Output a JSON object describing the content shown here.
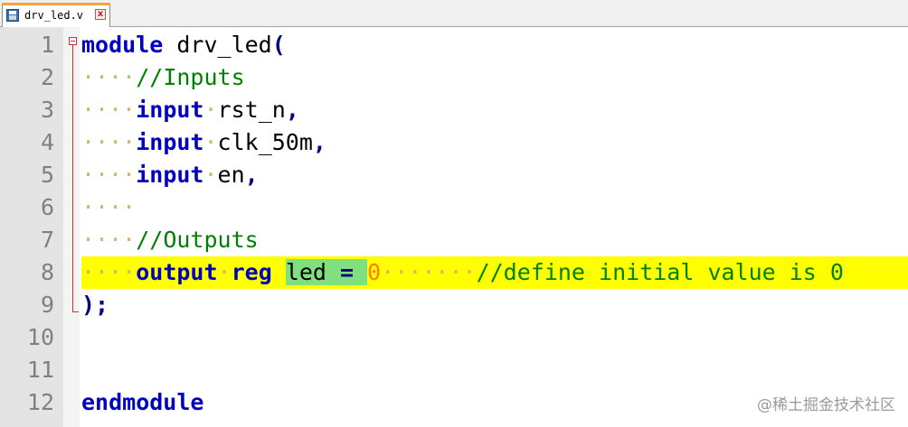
{
  "tab": {
    "filename": "drv_led.v",
    "close_glyph": "x",
    "icon": "save-icon"
  },
  "editor": {
    "lines": [
      {
        "no": "1",
        "indent": "",
        "tokens": [
          {
            "t": "module",
            "k": "kw"
          },
          {
            "t": " drv_led",
            "k": "id"
          },
          {
            "t": "(",
            "k": "op"
          }
        ]
      },
      {
        "no": "2",
        "indent": "····",
        "tokens": [
          {
            "t": "//Inputs",
            "k": "cm"
          }
        ]
      },
      {
        "no": "3",
        "indent": "····",
        "tokens": [
          {
            "t": "input",
            "k": "kw"
          },
          {
            "t": "·",
            "k": "ws"
          },
          {
            "t": "rst_n",
            "k": "id"
          },
          {
            "t": ",",
            "k": "op"
          }
        ]
      },
      {
        "no": "4",
        "indent": "····",
        "tokens": [
          {
            "t": "input",
            "k": "kw"
          },
          {
            "t": "·",
            "k": "ws"
          },
          {
            "t": "clk_50m",
            "k": "id"
          },
          {
            "t": ",",
            "k": "op"
          }
        ]
      },
      {
        "no": "5",
        "indent": "····",
        "tokens": [
          {
            "t": "input",
            "k": "kw"
          },
          {
            "t": "·",
            "k": "ws"
          },
          {
            "t": "en",
            "k": "id"
          },
          {
            "t": ",",
            "k": "op"
          }
        ]
      },
      {
        "no": "6",
        "indent": "····",
        "tokens": []
      },
      {
        "no": "7",
        "indent": "····",
        "tokens": [
          {
            "t": "//Outputs",
            "k": "cm"
          }
        ]
      },
      {
        "no": "8",
        "indent": "····",
        "highlight": true,
        "tokens": [
          {
            "t": "output",
            "k": "kw"
          },
          {
            "t": "·",
            "k": "ws"
          },
          {
            "t": "reg",
            "k": "kw"
          },
          {
            "t": " ",
            "k": "ws"
          },
          {
            "t": "led",
            "k": "id",
            "sel": true
          },
          {
            "t": " ",
            "k": "ws",
            "sel": true
          },
          {
            "t": "=",
            "k": "op",
            "sel": true
          },
          {
            "t": " ",
            "k": "ws",
            "sel": true
          },
          {
            "t": "0",
            "k": "num"
          },
          {
            "t": "·······",
            "k": "ws"
          },
          {
            "t": "//define initial value is 0",
            "k": "cm"
          }
        ]
      },
      {
        "no": "9",
        "indent": "",
        "tokens": [
          {
            "t": ");",
            "k": "op"
          }
        ]
      },
      {
        "no": "10",
        "indent": "",
        "tokens": []
      },
      {
        "no": "11",
        "indent": "",
        "tokens": []
      },
      {
        "no": "12",
        "indent": "",
        "tokens": [
          {
            "t": "endmodule",
            "k": "kw"
          }
        ]
      }
    ]
  },
  "watermark": "@稀土掘金技术社区",
  "colors": {
    "keyword": "#0000c0",
    "comment": "#008000",
    "number": "#ff8000",
    "line_highlight": "#ffff00",
    "selection": "#80e080",
    "fold_marker": "#d03030"
  }
}
